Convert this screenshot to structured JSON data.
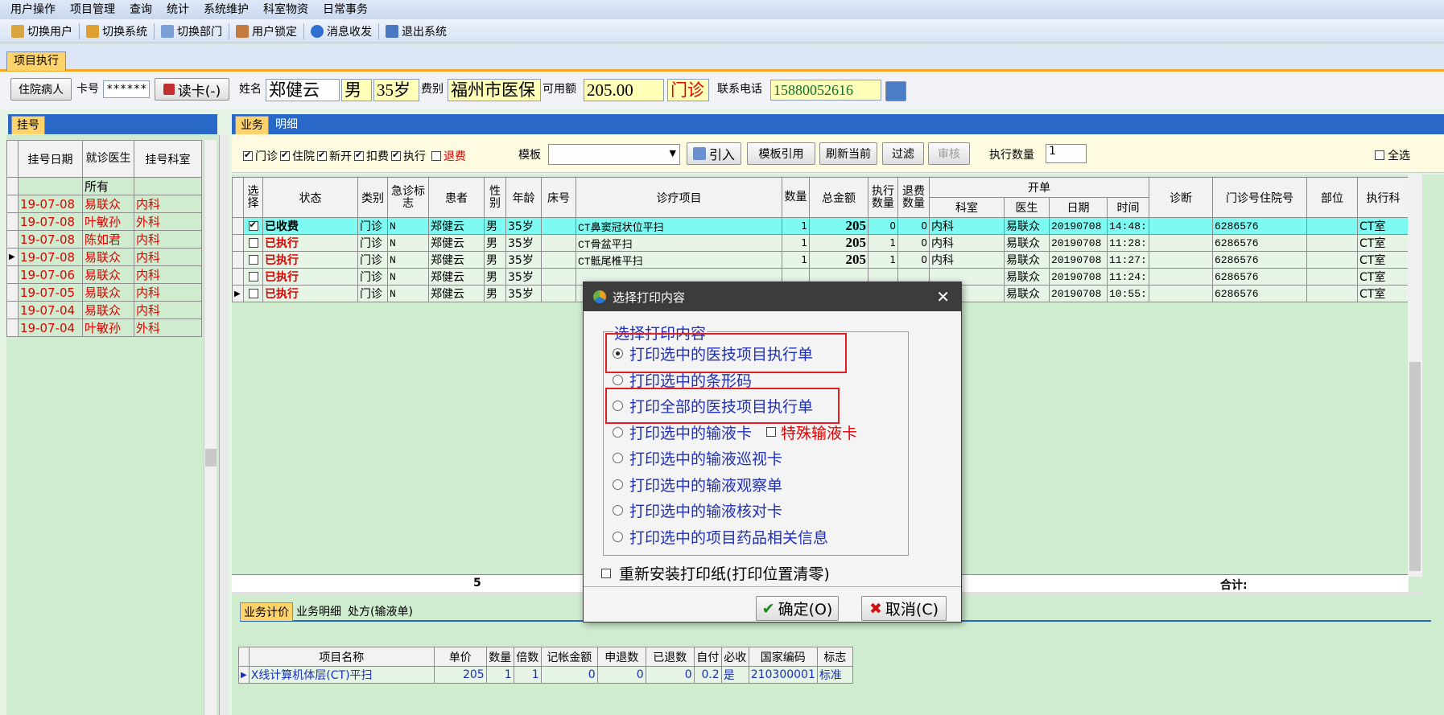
{
  "menu": [
    "用户操作",
    "项目管理",
    "查询",
    "统计",
    "系统维护",
    "科室物资",
    "日常事务"
  ],
  "toolbar": [
    "切换用户",
    "切换系统",
    "切换部门",
    "用户锁定",
    "消息收发",
    "退出系统"
  ],
  "main_tab": "项目执行",
  "patient": {
    "type_btn": "住院病人",
    "card_label": "卡号",
    "card_value": "******",
    "read_card": "读卡(-)",
    "name_label": "姓名",
    "name": "郑健云",
    "sex": "男",
    "age": "35岁",
    "fee_label": "费别",
    "fee_type": "福州市医保",
    "balance_label": "可用额",
    "balance": "205.00",
    "visit": "门诊",
    "phone_label": "联系电话",
    "phone": "15880052616"
  },
  "left": {
    "tab": "挂号",
    "headers": [
      "挂号日期",
      "就诊医生",
      "挂号科室"
    ],
    "all": "所有",
    "rows": [
      [
        "19-07-08",
        "易联众",
        "内科"
      ],
      [
        "19-07-08",
        "叶敏孙",
        "外科"
      ],
      [
        "19-07-08",
        "陈如君",
        "内科"
      ],
      [
        "19-07-08",
        "易联众",
        "内科"
      ],
      [
        "19-07-06",
        "易联众",
        "内科"
      ],
      [
        "19-07-05",
        "易联众",
        "内科"
      ],
      [
        "19-07-04",
        "易联众",
        "内科"
      ],
      [
        "19-07-04",
        "叶敏孙",
        "外科"
      ]
    ]
  },
  "biz_tabs": [
    "业务",
    "明细"
  ],
  "filters": {
    "mz": "门诊",
    "zy": "住院",
    "xk": "新开",
    "kf": "扣费",
    "zx": "执行",
    "tf": "退费",
    "template_label": "模板",
    "import": "引入",
    "tpl_ref": "模板引用",
    "refresh": "刷新当前",
    "filter": "过滤",
    "audit": "审核",
    "exec_qty_label": "执行数量",
    "exec_qty": "1",
    "select_all": "全选"
  },
  "grid": {
    "headers": [
      "选择",
      "状态",
      "类别",
      "急诊标志",
      "患者",
      "性别",
      "年龄",
      "床号",
      "诊疗项目",
      "数量",
      "总金额",
      "执行数量",
      "退费数量",
      "开单",
      "诊断",
      "门诊号住院号",
      "部位",
      "执行科"
    ],
    "sub": [
      "科室",
      "医生",
      "日期",
      "时间"
    ],
    "rows": [
      {
        "status": "已收费",
        "cat": "门诊",
        "urg": "N",
        "pat": "郑健云",
        "sex": "男",
        "age": "35岁",
        "item": "CT鼻窦冠状位平扫",
        "qty": "1",
        "amt": "205",
        "ex": "0",
        "rf": "0",
        "dept": "内科",
        "doc": "易联众",
        "date": "20190708",
        "time": "14:48:",
        "no": "6286576",
        "exd": "CT室"
      },
      {
        "status": "已执行",
        "cat": "门诊",
        "urg": "N",
        "pat": "郑健云",
        "sex": "男",
        "age": "35岁",
        "item": "CT骨盆平扫",
        "qty": "1",
        "amt": "205",
        "ex": "1",
        "rf": "0",
        "dept": "内科",
        "doc": "易联众",
        "date": "20190708",
        "time": "11:28:",
        "no": "6286576",
        "exd": "CT室"
      },
      {
        "status": "已执行",
        "cat": "门诊",
        "urg": "N",
        "pat": "郑健云",
        "sex": "男",
        "age": "35岁",
        "item": "CT骶尾椎平扫",
        "qty": "1",
        "amt": "205",
        "ex": "1",
        "rf": "0",
        "dept": "内科",
        "doc": "易联众",
        "date": "20190708",
        "time": "11:27:",
        "no": "6286576",
        "exd": "CT室"
      },
      {
        "status": "已执行",
        "cat": "门诊",
        "urg": "N",
        "pat": "郑健云",
        "sex": "男",
        "age": "35岁",
        "item": "",
        "qty": "",
        "amt": "",
        "ex": "",
        "rf": "",
        "dept": "",
        "doc": "易联众",
        "date": "20190708",
        "time": "11:24:",
        "no": "6286576",
        "exd": "CT室"
      },
      {
        "status": "已执行",
        "cat": "门诊",
        "urg": "N",
        "pat": "郑健云",
        "sex": "男",
        "age": "35岁",
        "item": "",
        "qty": "",
        "amt": "",
        "ex": "",
        "rf": "",
        "dept": "",
        "doc": "易联众",
        "date": "20190708",
        "time": "10:55:",
        "no": "6286576",
        "exd": "CT室"
      }
    ],
    "footer_count": "5",
    "footer_total": "合计:"
  },
  "bottom": {
    "tabs": [
      "业务计价",
      "业务明细",
      "处方(输液单)"
    ],
    "headers": [
      "项目名称",
      "单价",
      "数量",
      "倍数",
      "记帐金额",
      "申退数",
      "已退数",
      "自付",
      "必收",
      "国家编码",
      "标志"
    ],
    "row": [
      "X线计算机体层(CT)平扫",
      "205",
      "1",
      "1",
      "0",
      "0",
      "0",
      "0.2",
      "是",
      "210300001",
      "标准"
    ]
  },
  "dialog": {
    "title": "选择打印内容",
    "group": "选择打印内容",
    "options": [
      "打印选中的医技项目执行单",
      "打印选中的条形码",
      "打印全部的医技项目执行单",
      "打印选中的输液卡",
      "打印选中的输液巡视卡",
      "打印选中的输液观察单",
      "打印选中的输液核对卡",
      "打印选中的项目药品相关信息"
    ],
    "special": "特殊输液卡",
    "reinstall": "重新安装打印纸(打印位置清零)",
    "ok": "确定(O)",
    "cancel": "取消(C)"
  }
}
